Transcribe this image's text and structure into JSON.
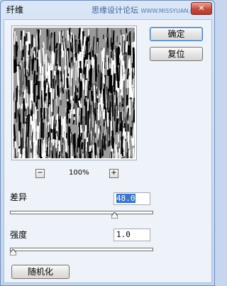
{
  "window": {
    "title": "纤维",
    "watermark_cn": "思缘设计论坛",
    "watermark_en": "WWW.MISSYUAN.COM",
    "close_glyph": "✕"
  },
  "buttons": {
    "ok": "确定",
    "reset": "复位",
    "randomize": "随机化"
  },
  "zoom": {
    "minus": "−",
    "value": "100%",
    "plus": "+"
  },
  "variance": {
    "label": "差异",
    "value": "48.0",
    "fraction": 0.74
  },
  "strength": {
    "label": "强度",
    "value": "1.0",
    "fraction": 0.0
  }
}
